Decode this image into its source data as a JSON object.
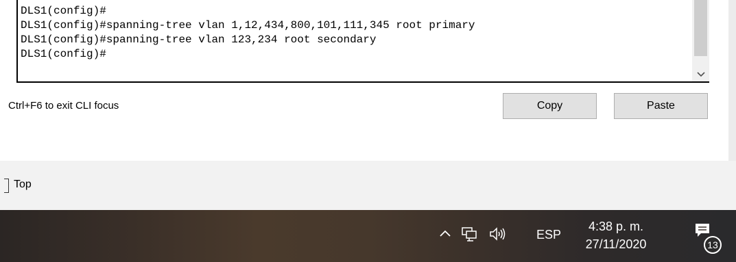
{
  "cli": {
    "lines": [
      "DLS1(config)#",
      "DLS1(config)#spanning-tree vlan 1,12,434,800,101,111,345 root primary",
      "DLS1(config)#spanning-tree vlan 123,234 root secondary",
      "DLS1(config)#"
    ]
  },
  "hint": "Ctrl+F6 to exit CLI focus",
  "buttons": {
    "copy": "Copy",
    "paste": "Paste"
  },
  "top_checkbox": {
    "label": "Top"
  },
  "taskbar": {
    "language": "ESP",
    "time": "4:38 p. m.",
    "date": "27/11/2020",
    "notification_count": "13",
    "icons": [
      "chevron-up-icon",
      "network-icon",
      "volume-icon",
      "notification-icon"
    ]
  }
}
